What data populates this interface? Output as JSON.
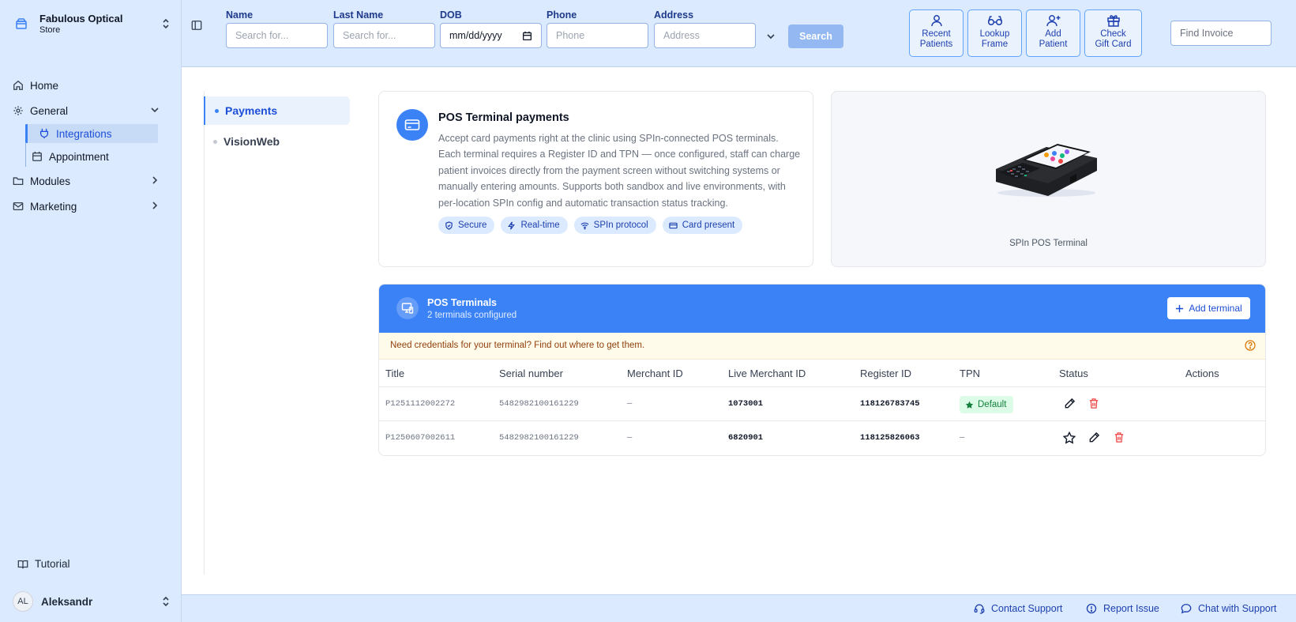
{
  "sidebar": {
    "store_name": "Fabulous Optical",
    "store_sub": "Store",
    "nav": {
      "home": "Home",
      "general": "General",
      "integrations": "Integrations",
      "appointment": "Appointment",
      "modules": "Modules",
      "marketing": "Marketing"
    },
    "tutorial": "Tutorial",
    "user_initials": "AL",
    "user_name": "Aleksandr"
  },
  "header": {
    "fields": {
      "name_label": "Name",
      "name_placeholder": "Search for...",
      "last_name_label": "Last Name",
      "last_name_placeholder": "Search for...",
      "dob_label": "DOB",
      "dob_value": "mm/dd/yyyy",
      "phone_label": "Phone",
      "phone_placeholder": "Phone",
      "address_label": "Address",
      "address_placeholder": "Address"
    },
    "search_button": "Search",
    "quick_actions": [
      {
        "line1": "Recent",
        "line2": "Patients",
        "icon": "user-icon"
      },
      {
        "line1": "Lookup",
        "line2": "Frame",
        "icon": "glasses-icon"
      },
      {
        "line1": "Add",
        "line2": "Patient",
        "icon": "user-plus-icon"
      },
      {
        "line1": "Check",
        "line2": "Gift Card",
        "icon": "gift-icon"
      }
    ],
    "find_invoice_placeholder": "Find Invoice"
  },
  "subnav": {
    "payments": "Payments",
    "visionweb": "VisionWeb"
  },
  "info_card": {
    "title": "POS Terminal payments",
    "description": "Accept card payments right at the clinic using SPIn-connected POS terminals. Each terminal requires a Register ID and TPN — once configured, staff can charge patient invoices directly from the payment screen without switching systems or manually entering amounts. Supports both sandbox and live environments, with per-location SPIn config and automatic transaction status tracking.",
    "tags": [
      "Secure",
      "Real-time",
      "SPIn protocol",
      "Card present"
    ]
  },
  "image_card": {
    "caption": "SPIn POS Terminal"
  },
  "terminals": {
    "title": "POS Terminals",
    "subtitle": "2 terminals configured",
    "add_button": "Add terminal",
    "notice": "Need credentials for your terminal? Find out where to get them.",
    "columns": [
      "Title",
      "Serial number",
      "Merchant ID",
      "Live Merchant ID",
      "Register ID",
      "TPN",
      "Status",
      "Actions"
    ],
    "rows": [
      {
        "title": "P1251112002272",
        "serial": "5482982100161229",
        "merchant_id": "—",
        "live_merchant_id": "1073001",
        "register_id": "118126783745",
        "tpn": "",
        "status": "Default"
      },
      {
        "title": "P1250607002611",
        "serial": "5482982100161229",
        "merchant_id": "—",
        "live_merchant_id": "6820901",
        "register_id": "118125826063",
        "tpn": "—",
        "status": ""
      }
    ]
  },
  "footer": {
    "contact_support": "Contact Support",
    "report_issue": "Report Issue",
    "chat_support": "Chat with Support"
  },
  "colors": {
    "accent": "#3b82f6",
    "sidebar_bg": "#dbeafe",
    "delete": "#ef4444",
    "success": "#15803d"
  }
}
